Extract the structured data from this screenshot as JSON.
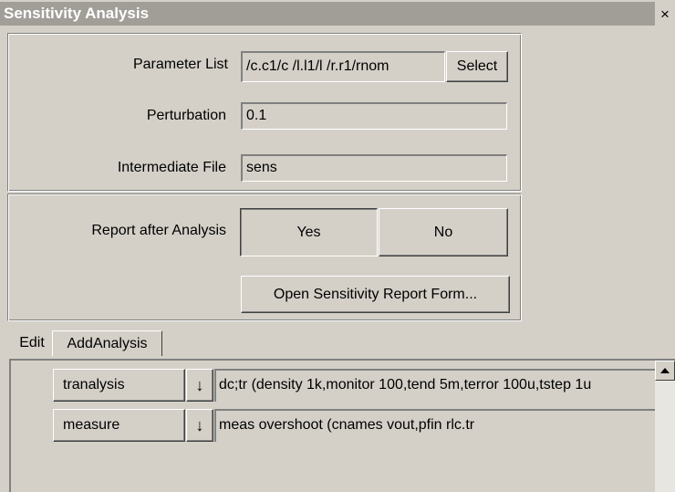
{
  "window": {
    "title": "Sensitivity Analysis",
    "close_glyph": "×"
  },
  "params": {
    "parameter_list_label": "Parameter List",
    "parameter_list_value": "/c.c1/c /l.l1/l /r.r1/rnom",
    "select_label": "Select",
    "perturbation_label": "Perturbation",
    "perturbation_value": "0.1",
    "intermediate_file_label": "Intermediate File",
    "intermediate_file_value": "sens"
  },
  "report": {
    "label": "Report after Analysis",
    "yes_label": "Yes",
    "no_label": "No",
    "selected": "Yes",
    "open_report_label": "Open Sensitivity Report Form..."
  },
  "tabs": [
    {
      "label": "Edit",
      "active": false
    },
    {
      "label": "AddAnalysis",
      "active": true
    }
  ],
  "analyses": [
    {
      "type": "tranalysis",
      "arrow": "↓",
      "command": "dc;tr (density 1k,monitor 100,tend 5m,terror 100u,tstep 1u"
    },
    {
      "type": "measure",
      "arrow": "↓",
      "command": "meas overshoot (cnames vout,pfin rlc.tr"
    }
  ]
}
